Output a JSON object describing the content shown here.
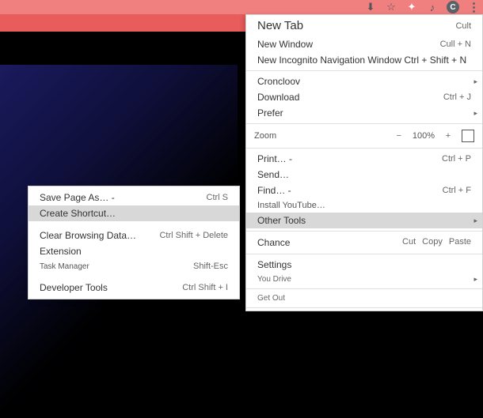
{
  "toolbar": {
    "avatar_letter": "C"
  },
  "main_menu": {
    "new_tab": {
      "label": "New Tab",
      "shortcut": "Cult"
    },
    "new_window": {
      "label": "New Window",
      "shortcut": "Cull + N"
    },
    "incognito": {
      "label": "New Incognito Navigation Window Ctrl + Shift + N",
      "shortcut": ""
    },
    "cronology": {
      "label": "Croncloov"
    },
    "download": {
      "label": "Download",
      "shortcut": "Ctrl + J"
    },
    "prefer": {
      "label": "Prefer"
    },
    "zoom": {
      "label": "Zoom",
      "minus": "−",
      "value": "100%",
      "plus": "+"
    },
    "print": {
      "label": "Print… -",
      "shortcut": "Ctrl + P"
    },
    "send": {
      "label": "Send…"
    },
    "find": {
      "label": "Find… -",
      "shortcut": "Ctrl + F"
    },
    "install": {
      "label": "Install YouTube…"
    },
    "other_tools": {
      "label": "Other Tools"
    },
    "edit": {
      "label": "Chance",
      "cut": "Cut",
      "copy": "Copy",
      "paste": "Paste"
    },
    "settings": {
      "label": "Settings"
    },
    "you_drive": {
      "label": "You Drive"
    },
    "get_out": {
      "label": "Get Out"
    }
  },
  "sub_menu": {
    "save_page": {
      "label": "Save Page As… -",
      "shortcut": "Ctrl S"
    },
    "create_shortcut": {
      "label": "Create Shortcut…"
    },
    "clear_data": {
      "label": "Clear Browsing Data…",
      "shortcut": "Ctrl Shift + Delete"
    },
    "extension": {
      "label": "Extension"
    },
    "task_manager": {
      "label": "Task Manager",
      "shortcut": "Shift-Esc"
    },
    "dev_tools": {
      "label": "Developer Tools",
      "shortcut": "Ctrl Shift + I"
    }
  }
}
